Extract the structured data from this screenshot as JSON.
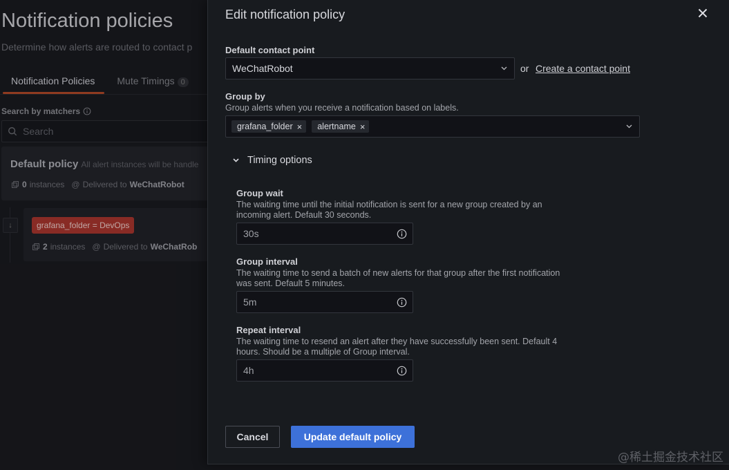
{
  "background": {
    "title": "Notification policies",
    "subtitle": "Determine how alerts are routed to contact p",
    "tabs": [
      {
        "label": "Notification Policies",
        "count": ""
      },
      {
        "label": "Mute Timings",
        "count": "0"
      }
    ],
    "search": {
      "label": "Search by matchers",
      "placeholder": "Search"
    },
    "default_policy": {
      "title": "Default policy",
      "description": "All alert instances will be handle",
      "instances_count": "0",
      "instances_label": "instances",
      "delivered_label": "Delivered to",
      "contact_point": "WeChatRobot"
    },
    "route": {
      "matcher": "grafana_folder = DevOps",
      "instances_count": "2",
      "instances_label": "instances",
      "delivered_label": "Delivered to",
      "contact_point": "WeChatRob"
    }
  },
  "drawer": {
    "title": "Edit notification policy",
    "contact_point": {
      "label": "Default contact point",
      "value": "WeChatRobot",
      "or_text": "or",
      "create_link": "Create a contact point"
    },
    "group_by": {
      "label": "Group by",
      "description": "Group alerts when you receive a notification based on labels.",
      "chips": [
        "grafana_folder",
        "alertname"
      ]
    },
    "timing": {
      "toggle_label": "Timing options",
      "expanded": true,
      "group_wait": {
        "label": "Group wait",
        "description": "The waiting time until the initial notification is sent for a new group created by an incoming alert. Default 30 seconds.",
        "placeholder": "30s"
      },
      "group_interval": {
        "label": "Group interval",
        "description": "The waiting time to send a batch of new alerts for that group after the first notification was sent. Default 5 minutes.",
        "placeholder": "5m"
      },
      "repeat_interval": {
        "label": "Repeat interval",
        "description": "The waiting time to resend an alert after they have successfully been sent. Default 4 hours. Should be a multiple of Group interval.",
        "placeholder": "4h"
      }
    },
    "buttons": {
      "cancel": "Cancel",
      "submit": "Update default policy"
    }
  },
  "watermark": "@稀土掘金技术社区",
  "colors": {
    "primary": "#3d71d9",
    "active_tab": "#f05a28",
    "tag": "#a4332a"
  }
}
